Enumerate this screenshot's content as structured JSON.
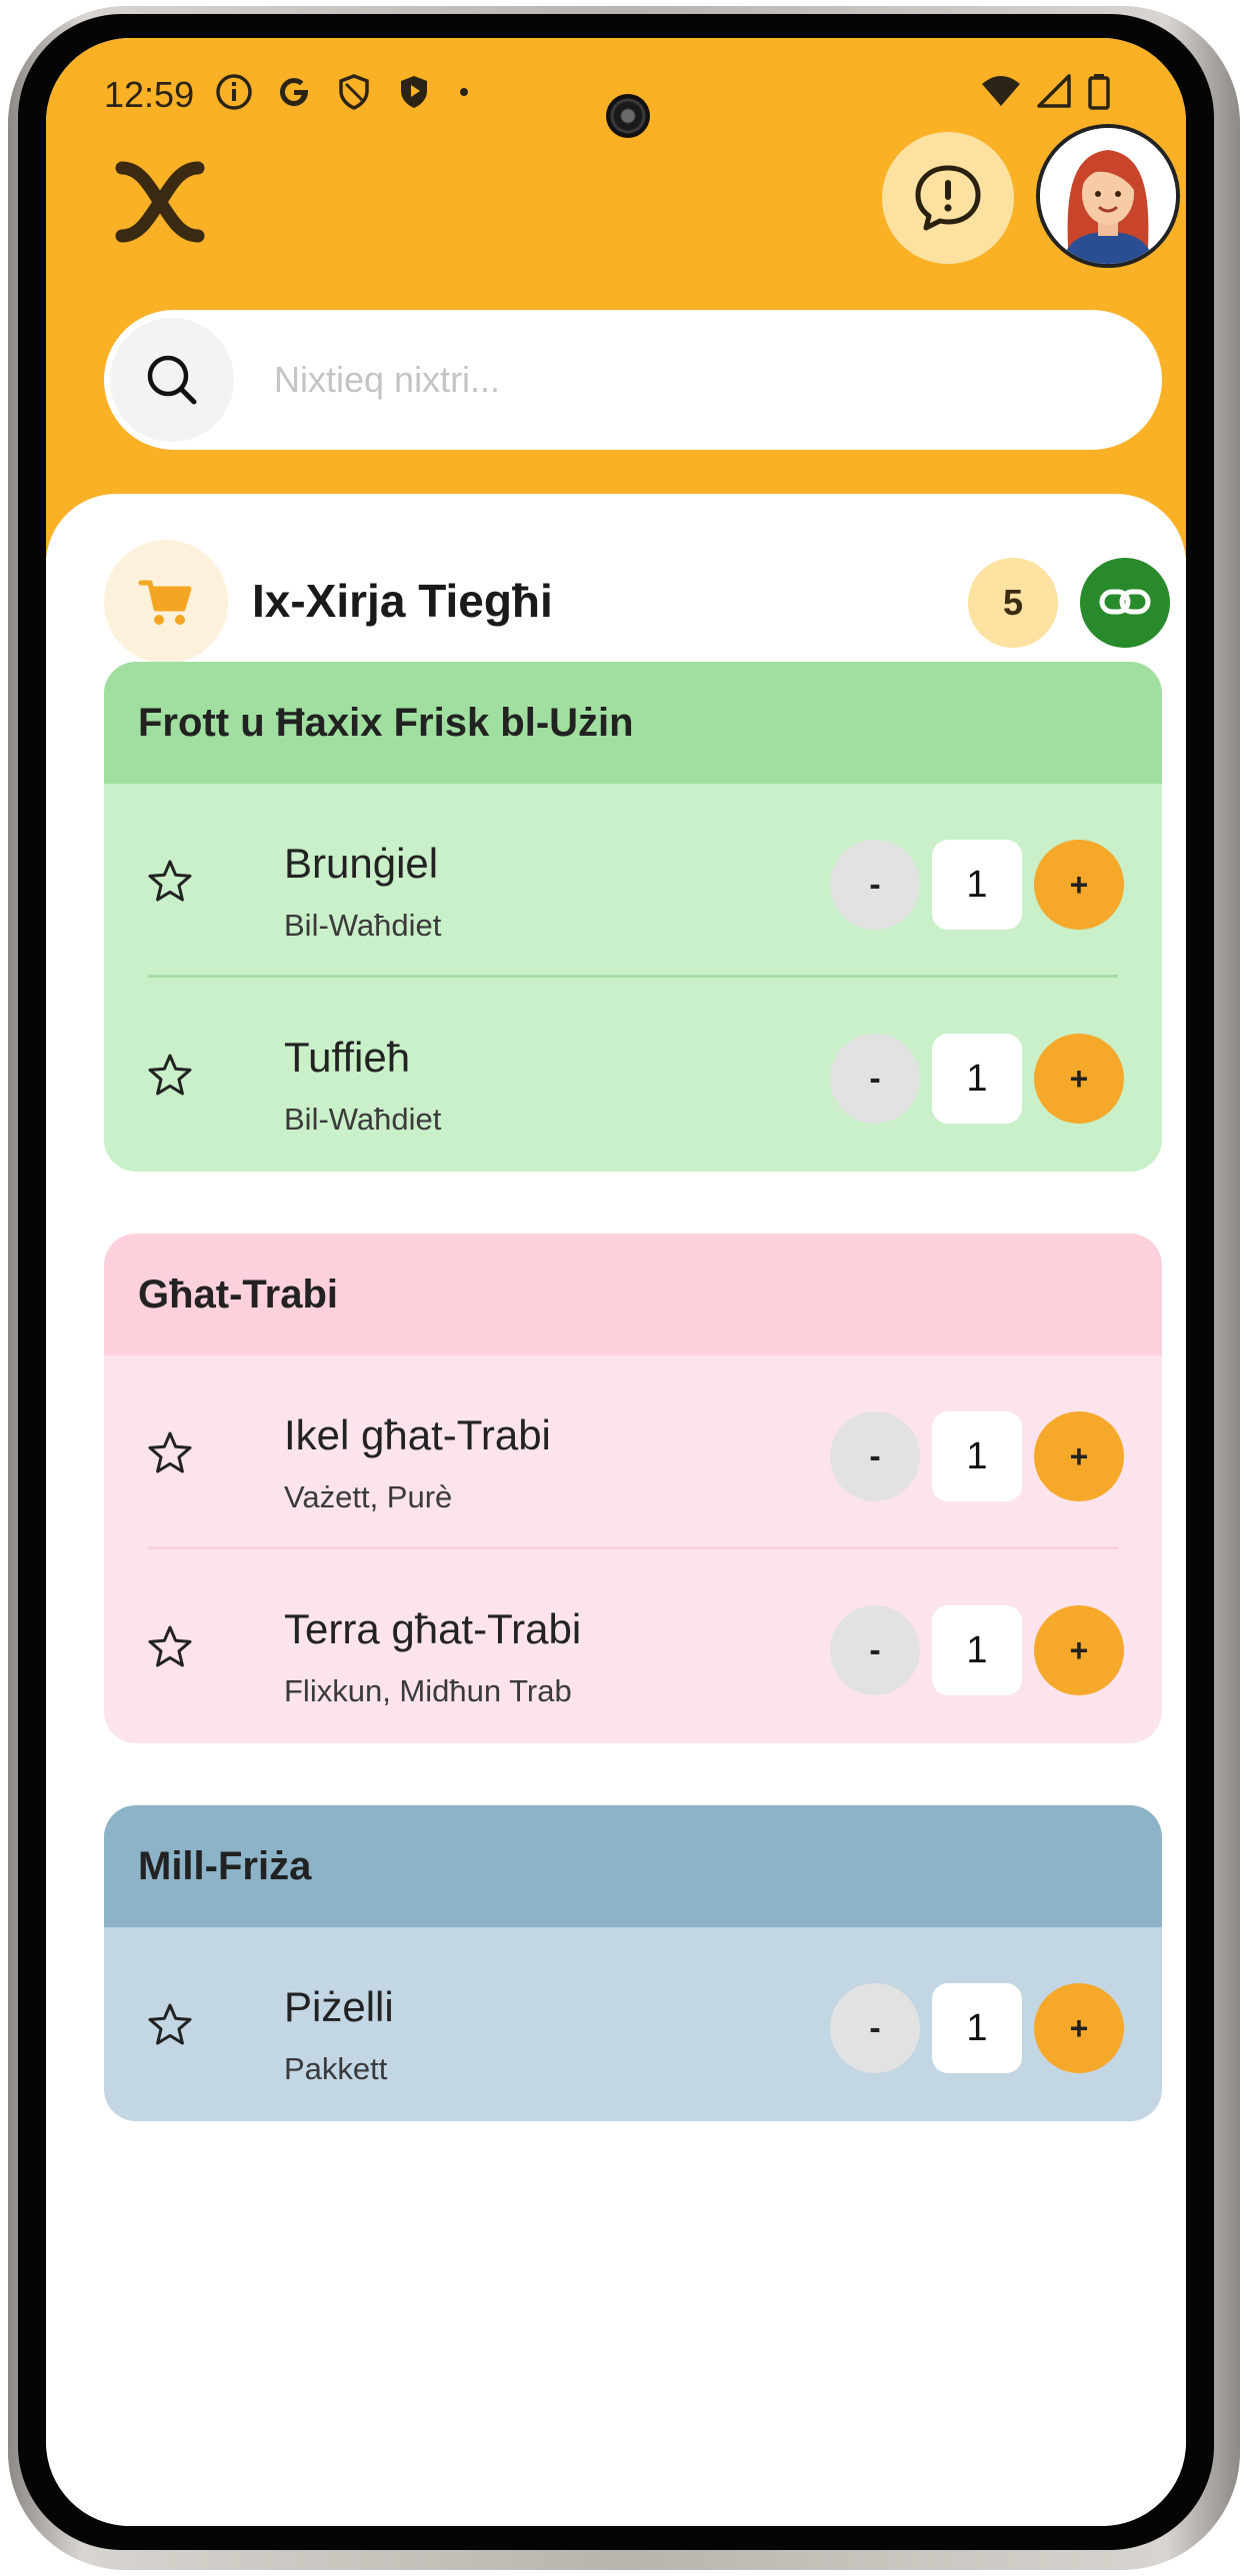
{
  "status_bar": {
    "time": "12:59"
  },
  "search": {
    "placeholder": "Nixtieq nixtri..."
  },
  "list": {
    "title": "Ix-Xirja Tiegħi",
    "count": "5"
  },
  "categories": [
    {
      "title": "Frott u Ħaxix Frisk bl-Użin",
      "header_color": "#a0df9f",
      "body_color": "#c9f0c8",
      "divider_color": "#a7dca6",
      "items": [
        {
          "name": "Brunġiel",
          "subtitle": "Bil-Waħdiet",
          "quantity": "1",
          "minus": "-",
          "plus": "+"
        },
        {
          "name": "Tuffieħ",
          "subtitle": "Bil-Waħdiet",
          "quantity": "1",
          "minus": "-",
          "plus": "+"
        }
      ]
    },
    {
      "title": "Għat-Trabi",
      "header_color": "#fdd1dc",
      "body_color": "#fde4ec",
      "divider_color": "#f6d2dc",
      "items": [
        {
          "name": "Ikel għat-Trabi",
          "subtitle": "Vażett, Purè",
          "quantity": "1",
          "minus": "-",
          "plus": "+"
        },
        {
          "name": "Terra għat-Trabi",
          "subtitle": "Flixkun, Midħun Trab",
          "quantity": "1",
          "minus": "-",
          "plus": "+"
        }
      ]
    },
    {
      "title": "Mill-Friża",
      "header_color": "#8cb3c8",
      "body_color": "#c3d6e3",
      "divider_color": "#aac3d3",
      "items": [
        {
          "name": "Piżelli",
          "subtitle": "Pakkett",
          "quantity": "1",
          "minus": "-",
          "plus": "+"
        }
      ]
    }
  ],
  "colors": {
    "header_bg": "#fab126",
    "accent": "#f6a82b",
    "share_green": "#288a2b"
  },
  "icons": [
    "app-logo-icon",
    "alert-icon",
    "avatar",
    "search-icon",
    "cart-icon",
    "link-icon",
    "star-icon"
  ]
}
